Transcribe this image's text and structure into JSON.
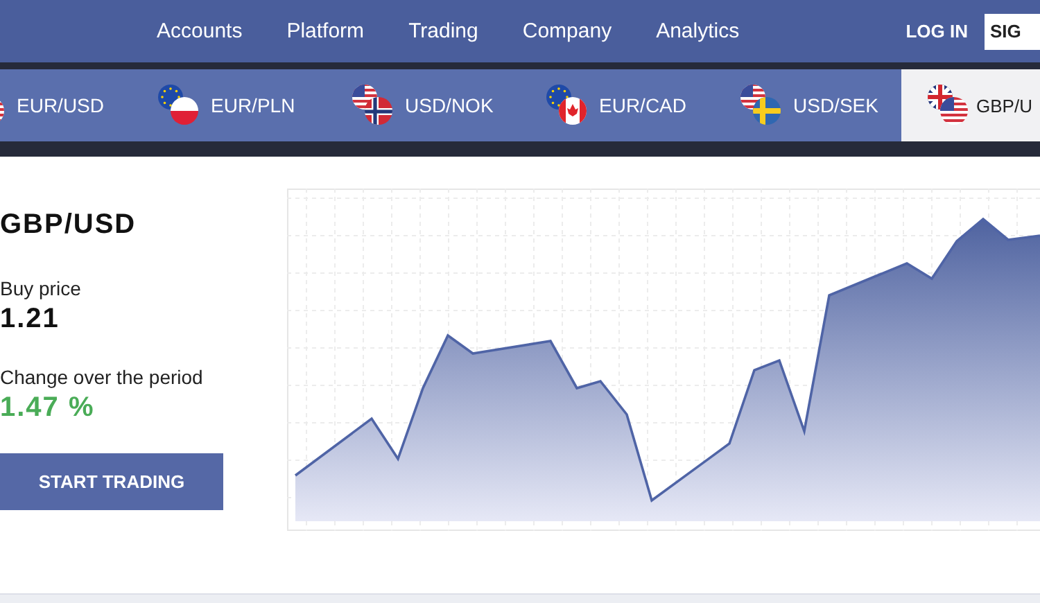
{
  "nav": {
    "items": [
      "Accounts",
      "Platform",
      "Trading",
      "Company",
      "Analytics"
    ],
    "login": "LOG IN",
    "signup": "SIG"
  },
  "pairs": [
    {
      "label": "EUR/USD",
      "selected": false
    },
    {
      "label": "EUR/PLN",
      "selected": false
    },
    {
      "label": "USD/NOK",
      "selected": false
    },
    {
      "label": "EUR/CAD",
      "selected": false
    },
    {
      "label": "USD/SEK",
      "selected": false
    },
    {
      "label": "GBP/U",
      "selected": true
    }
  ],
  "quote": {
    "pair": "GBP/USD",
    "buy_label": "Buy price",
    "buy_value": "1.21",
    "change_label": "Change over the period",
    "change_value": "1.47 %",
    "button": "START TRADING"
  }
}
